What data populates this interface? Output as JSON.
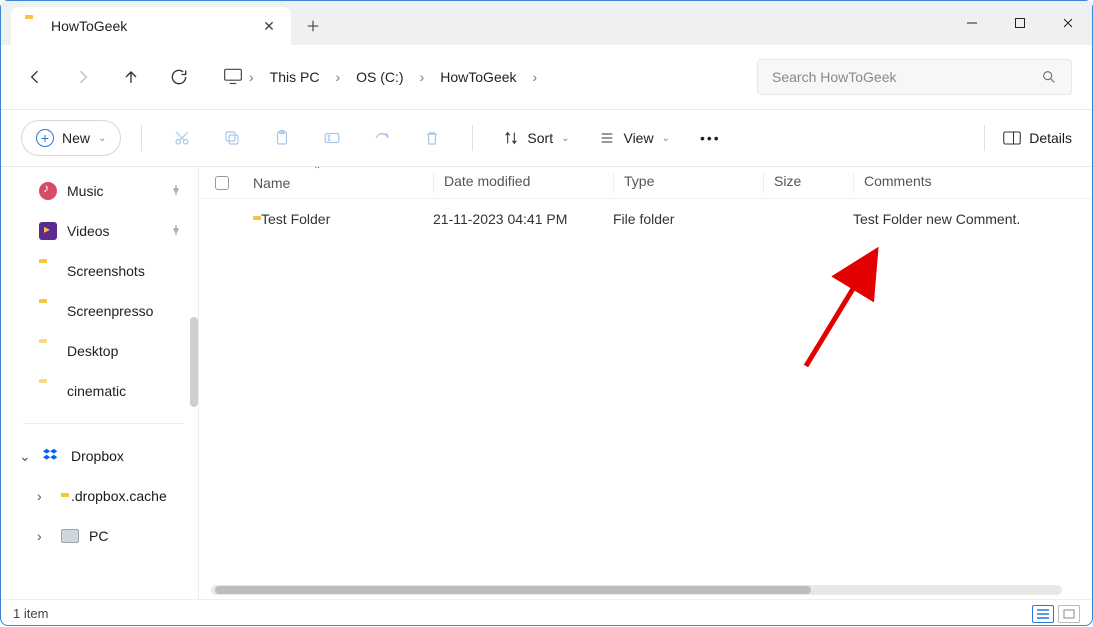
{
  "tab": {
    "title": "HowToGeek"
  },
  "breadcrumbs": {
    "b0": "This PC",
    "b1": "OS (C:)",
    "b2": "HowToGeek"
  },
  "search": {
    "placeholder": "Search HowToGeek"
  },
  "toolbar": {
    "new_label": "New",
    "sort_label": "Sort",
    "view_label": "View",
    "details_label": "Details"
  },
  "columns": {
    "name": "Name",
    "date": "Date modified",
    "type": "Type",
    "size": "Size",
    "comments": "Comments"
  },
  "rows": {
    "r0": {
      "name": "Test Folder",
      "date": "21-11-2023 04:41 PM",
      "type": "File folder",
      "size": "",
      "comments": "Test Folder new Comment."
    }
  },
  "sidebar": {
    "items": {
      "music": "Music",
      "videos": "Videos",
      "screenshots": "Screenshots",
      "screenpresso": "Screenpresso",
      "desktop": "Desktop",
      "cinematic": "cinematic"
    },
    "dropbox": "Dropbox",
    "dcache": ".dropbox.cache",
    "pc": "PC"
  },
  "status": {
    "count": "1 item"
  }
}
